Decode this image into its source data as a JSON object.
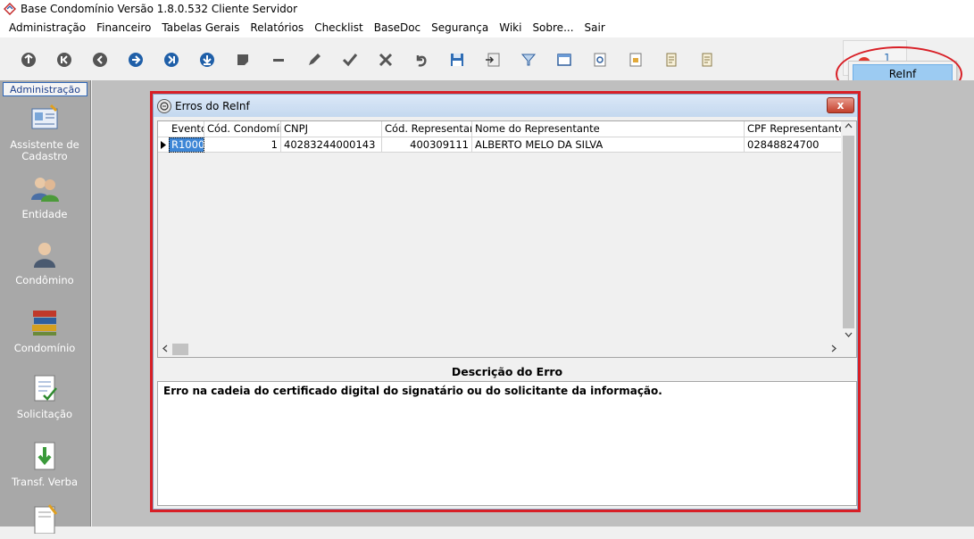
{
  "window": {
    "title": "Base Condomínio Versão 1.8.0.532 Cliente Servidor"
  },
  "menu": [
    "Administração",
    "Financeiro",
    "Tabelas Gerais",
    "Relatórios",
    "Checklist",
    "BaseDoc",
    "Segurança",
    "Wiki",
    "Sobre...",
    "Sair"
  ],
  "toolbar_icons": [
    "first-icon",
    "prev-page-icon",
    "prev-icon",
    "next-icon",
    "next-page-icon",
    "last-icon",
    "note-icon",
    "minus-icon",
    "edit-icon",
    "check-icon",
    "delete-icon",
    "undo-icon",
    "save-icon",
    "import-icon",
    "filter-icon",
    "window-icon",
    "preview-icon",
    "print-icon",
    "report-icon",
    "report2-icon"
  ],
  "notification": {
    "count": "1",
    "popup_item": "ReInf"
  },
  "sidebar": {
    "header": "Administração",
    "items": [
      {
        "label": "Assistente de Cadastro",
        "icon": "wizard-icon"
      },
      {
        "label": "Entidade",
        "icon": "people-icon"
      },
      {
        "label": "Condômino",
        "icon": "person-icon"
      },
      {
        "label": "Condomínio",
        "icon": "books-icon"
      },
      {
        "label": "Solicitação",
        "icon": "checklist-icon"
      },
      {
        "label": "Transf. Verba",
        "icon": "transfer-icon"
      }
    ]
  },
  "dialog": {
    "title": "Erros do ReInf",
    "close": "x",
    "columns": [
      "Evento",
      "Cód. Condomínio",
      "CNPJ",
      "Cód. Representante",
      "Nome do Representante",
      "CPF Representante"
    ],
    "rows": [
      [
        "R1000",
        "1",
        "40283244000143",
        "400309111",
        "ALBERTO MELO DA SILVA",
        "02848824700"
      ]
    ],
    "description_header": "Descrição do Erro",
    "description_text": "Erro na cadeia do certificado digital do signatário ou do solicitante da informação."
  },
  "colors": {
    "highlight": "#d81f26",
    "selection": "#3d86d6",
    "sidebar": "#a8a8a8"
  }
}
